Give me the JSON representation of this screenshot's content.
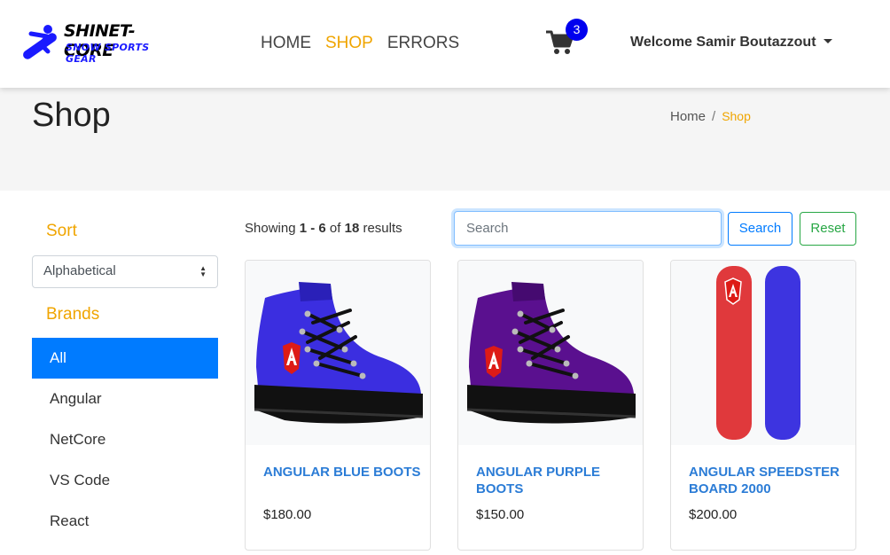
{
  "brand": {
    "line1": "SHINET-CORE",
    "line2": "SNOW SPORTS GEAR"
  },
  "nav": {
    "links": [
      {
        "label": "HOME"
      },
      {
        "label": "SHOP"
      },
      {
        "label": "ERRORS"
      }
    ]
  },
  "cart": {
    "count": "3"
  },
  "user": {
    "welcome": "Welcome Samir Boutazzout"
  },
  "header": {
    "title": "Shop",
    "breadcrumb": {
      "home": "Home",
      "separator": "/",
      "current": "Shop"
    }
  },
  "sidebar": {
    "sort_title": "Sort",
    "sort_selected": "Alphabetical",
    "brands_title": "Brands",
    "brands": [
      {
        "label": "All"
      },
      {
        "label": "Angular"
      },
      {
        "label": "NetCore"
      },
      {
        "label": "VS Code"
      },
      {
        "label": "React"
      }
    ]
  },
  "toolbar": {
    "showing": "Showing",
    "range_start": "1",
    "range_dash": " - ",
    "range_end": "6",
    "of": "of",
    "total": "18",
    "results": "results",
    "search_placeholder": "Search",
    "search_label": "Search",
    "reset_label": "Reset"
  },
  "products": [
    {
      "name": "Angular Blue Boots",
      "price": "$180.00"
    },
    {
      "name": "Angular Purple Boots",
      "price": "$150.00"
    },
    {
      "name": "Angular Speedster Board 2000",
      "price": "$200.00"
    }
  ],
  "colors": {
    "accent": "#f0a500",
    "primary": "#007bff",
    "success": "#28a745",
    "badge": "#0000ee",
    "link": "#2b7cd6"
  },
  "icons": {
    "logo": "snowboarder-logo-icon",
    "cart": "shopping-cart-icon",
    "dropdown": "caret-down-icon",
    "select": "select-arrows-icon",
    "angular": "angular-logo-icon"
  }
}
